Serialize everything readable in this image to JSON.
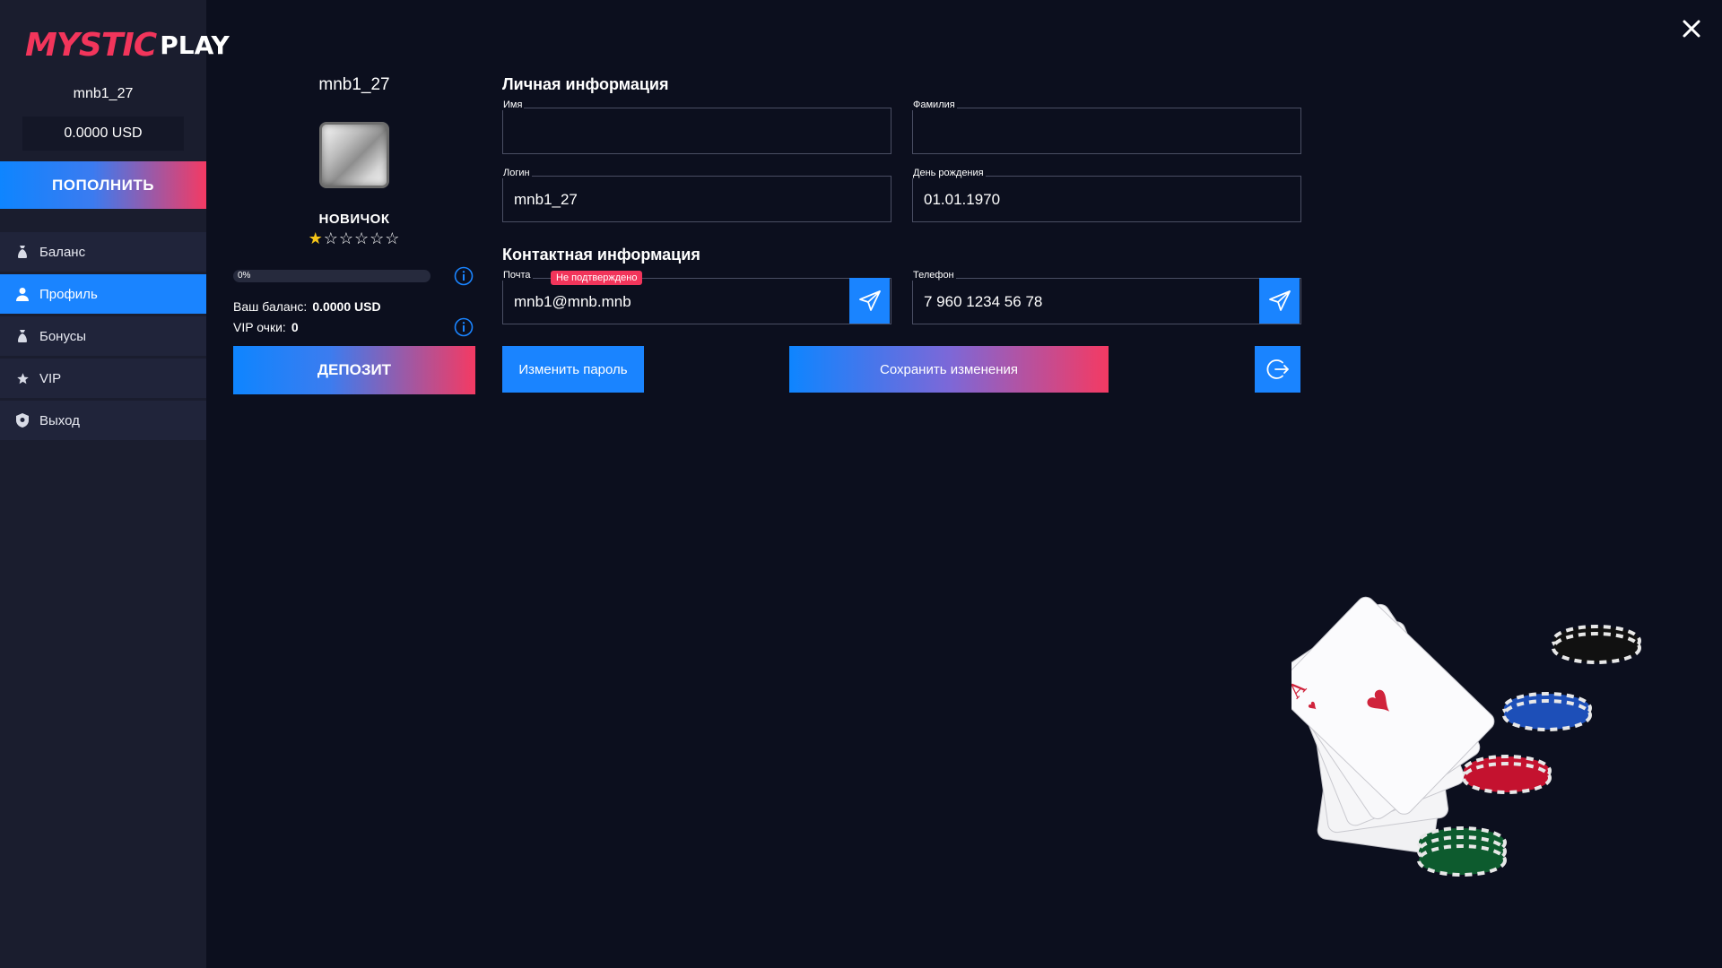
{
  "brand": {
    "name_part1": "MYSTIC",
    "name_part2": "PLAY"
  },
  "sidebar": {
    "username": "mnb1_27",
    "balance": "0.0000 USD",
    "topup_label": "ПОПОЛНИТЬ",
    "items": [
      {
        "label": "Баланс",
        "icon": "moneybag-icon",
        "active": false
      },
      {
        "label": "Профиль",
        "icon": "user-icon",
        "active": true
      },
      {
        "label": "Бонусы",
        "icon": "moneybag-icon",
        "active": false
      },
      {
        "label": "VIP",
        "icon": "star-icon",
        "active": false
      },
      {
        "label": "Выход",
        "icon": "shield-icon",
        "active": false
      }
    ]
  },
  "profile": {
    "username": "mnb1_27",
    "rank": "НОВИЧОК",
    "stars_total": 6,
    "stars_filled": 1,
    "progress_label": "0%",
    "progress_value": 0,
    "balance_label": "Ваш баланс:",
    "balance_value": "0.0000 USD",
    "vip_label": "VIP очки:",
    "vip_value": "0",
    "deposit_label": "ДЕПОЗИТ"
  },
  "personal": {
    "title": "Личная информация",
    "first_name": {
      "label": "Имя",
      "value": ""
    },
    "last_name": {
      "label": "Фамилия",
      "value": ""
    },
    "login": {
      "label": "Логин",
      "value": "mnb1_27"
    },
    "birthday": {
      "label": "День рождения",
      "value": "01.01.1970"
    }
  },
  "contact": {
    "title": "Контактная информация",
    "email": {
      "label": "Почта",
      "badge": "Не подтверждено",
      "value": "mnb1@mnb.mnb"
    },
    "phone": {
      "label": "Телефон",
      "value": "7 960 1234 56 78"
    }
  },
  "actions": {
    "change_password": "Изменить пароль",
    "save": "Сохранить изменения"
  },
  "colors": {
    "accent_blue": "#1a84ff",
    "accent_pink": "#f43a63",
    "background": "#0c0f1e",
    "sidebar": "#1a1d2e"
  }
}
